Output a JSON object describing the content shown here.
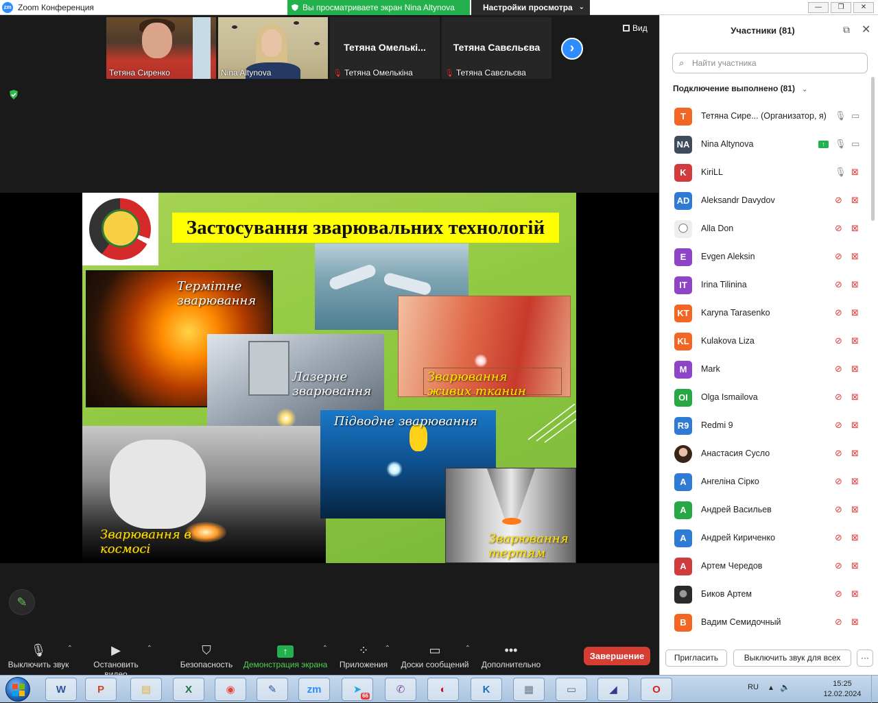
{
  "window": {
    "title": "Zoom Конференция",
    "share_banner": "Вы просматриваете экран Nina Altynova",
    "view_options": "Настройки просмотра",
    "btn_min": "—",
    "btn_max": "❐",
    "btn_close": "✕"
  },
  "thumbnails": [
    {
      "name": "Тетяна Сиренко",
      "video": true
    },
    {
      "name": "Nina Altynova",
      "video": true,
      "active": true
    },
    {
      "name": "Тетяна Омелькіна",
      "display": "Тетяна  Омелькі...",
      "muted": true
    },
    {
      "name": "Тетяна Савєльєва",
      "display": "Тетяна Савєльєва",
      "muted": true
    }
  ],
  "view_button": "Вид",
  "slide": {
    "title": "Застосування зварювальних технологій",
    "captions": {
      "thermite": "Термітне\nзварювання",
      "laser": "Лазерне\nзварювання",
      "tissue": "Зварювання\nживих тканин",
      "underwater": "Підводне зварювання",
      "space": "Зварювання в\nкосмосі",
      "friction": "Зварювання\nтертям"
    }
  },
  "toolbar": {
    "mute": "Выключить звук",
    "stop_video": "Остановить видео",
    "security": "Безопасность",
    "share": "Демонстрация экрана",
    "apps": "Приложения",
    "whiteboards": "Доски сообщений",
    "more": "Дополнительно",
    "end": "Завершение"
  },
  "participants_panel": {
    "title": "Участники (81)",
    "search_placeholder": "Найти участника",
    "section": "Подключение выполнено (81)",
    "invite": "Пригласить",
    "mute_all": "Выключить звук для всех",
    "more": "···",
    "list": [
      {
        "initials": "T",
        "color": "#f26522",
        "name": "Тетяна Сире...  (Организатор, я)",
        "mic": "on",
        "cam": "on"
      },
      {
        "initials": "NA",
        "color": "#3d4b5c",
        "name": "Nina Altynova",
        "mic": "on",
        "cam": "on",
        "sharing": true
      },
      {
        "initials": "K",
        "color": "#d13b3b",
        "name": "KiriLL",
        "mic": "on",
        "cam": "off"
      },
      {
        "initials": "AD",
        "color": "#2f7bd3",
        "name": "Aleksandr Davydov",
        "mic": "muted",
        "cam": "off"
      },
      {
        "initials": "",
        "color": "#dddddd",
        "name": "Alla Don",
        "mic": "muted",
        "cam": "off",
        "photo": "sketch"
      },
      {
        "initials": "E",
        "color": "#8e44c6",
        "name": "Evgen Aleksin",
        "mic": "muted",
        "cam": "off"
      },
      {
        "initials": "IT",
        "color": "#8e44c6",
        "name": "Irina Tilinina",
        "mic": "muted",
        "cam": "off"
      },
      {
        "initials": "KT",
        "color": "#f26522",
        "name": "Karyna Tarasenko",
        "mic": "muted",
        "cam": "off"
      },
      {
        "initials": "KL",
        "color": "#f26522",
        "name": "Kulakova Liza",
        "mic": "muted",
        "cam": "off"
      },
      {
        "initials": "M",
        "color": "#8e44c6",
        "name": "Mark",
        "mic": "muted",
        "cam": "off"
      },
      {
        "initials": "OI",
        "color": "#28a745",
        "name": "Olga Ismailova",
        "mic": "muted",
        "cam": "off"
      },
      {
        "initials": "R9",
        "color": "#2f7bd3",
        "name": "Redmi 9",
        "mic": "muted",
        "cam": "off"
      },
      {
        "initials": "",
        "color": "#5a3a2a",
        "name": "Анастасия Сусло",
        "mic": "muted",
        "cam": "off",
        "photo": "face"
      },
      {
        "initials": "A",
        "color": "#2f7bd3",
        "name": "Ангеліна Сірко",
        "mic": "muted",
        "cam": "off"
      },
      {
        "initials": "A",
        "color": "#28a745",
        "name": "Андрей Васильев",
        "mic": "muted",
        "cam": "off"
      },
      {
        "initials": "A",
        "color": "#2f7bd3",
        "name": "Андрей Кириченко",
        "mic": "muted",
        "cam": "off"
      },
      {
        "initials": "A",
        "color": "#d13b3b",
        "name": "Артем Чередов",
        "mic": "muted",
        "cam": "off"
      },
      {
        "initials": "",
        "color": "#333333",
        "name": "Биков Артем",
        "mic": "muted",
        "cam": "off",
        "photo": "dark"
      },
      {
        "initials": "B",
        "color": "#f26522",
        "name": "Вадим Семидочный",
        "mic": "muted",
        "cam": "off"
      }
    ]
  },
  "taskbar": {
    "apps": [
      {
        "name": "word",
        "label": "W",
        "color": "#2b579a"
      },
      {
        "name": "powerpoint",
        "label": "P",
        "color": "#d24726"
      },
      {
        "name": "explorer",
        "label": "▤",
        "color": "#e0b040"
      },
      {
        "name": "excel",
        "label": "X",
        "color": "#217346"
      },
      {
        "name": "chrome",
        "label": "◉",
        "color": "#e8453c"
      },
      {
        "name": "paint",
        "label": "✎",
        "color": "#3050a0"
      },
      {
        "name": "zoom",
        "label": "zm",
        "color": "#2d8cff"
      },
      {
        "name": "telegram",
        "label": "➤",
        "color": "#2aa3dd",
        "badge": "66"
      },
      {
        "name": "viber",
        "label": "✆",
        "color": "#7b519d"
      },
      {
        "name": "media",
        "label": "◐",
        "color": "#c8102e"
      },
      {
        "name": "k-app",
        "label": "K",
        "color": "#1f6fb0"
      },
      {
        "name": "calculator",
        "label": "▦",
        "color": "#6a7b8c"
      },
      {
        "name": "network",
        "label": "▭",
        "color": "#5a6a7a"
      },
      {
        "name": "editor",
        "label": "◢",
        "color": "#3a3a8a"
      },
      {
        "name": "opera",
        "label": "O",
        "color": "#e0201e"
      }
    ],
    "lang": "RU",
    "time": "15:25",
    "date": "12.02.2024"
  }
}
